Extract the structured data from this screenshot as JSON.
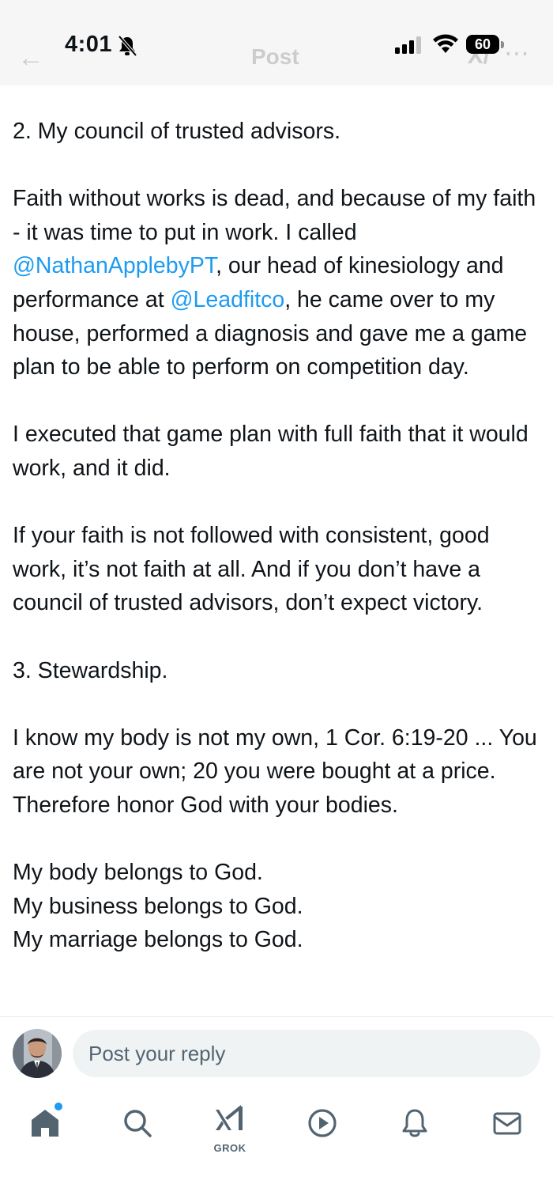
{
  "status_bar": {
    "time": "4:01",
    "battery": "60"
  },
  "header": {
    "back_icon": "back-arrow-icon",
    "title": "Post",
    "grok_icon": "grok-icon",
    "more_icon": "more-icon"
  },
  "post": {
    "paragraphs": [
      {
        "text": "2. My council of trusted advisors."
      },
      {
        "before": "Faith without works is dead, and because of my faith - it was time to put in work. I called ",
        "mention1": "@NathanApplebyPT",
        "middle": ", our head of kinesiology and performance at ",
        "mention2": "@Leadfitco",
        "after": ", he came over to my house, performed a diagnosis and gave me a game plan to be able to perform on competition day."
      },
      {
        "text": "I executed that game plan with full faith that it would work, and it did."
      },
      {
        "text": "If your faith is not followed with consistent, good work, it’s not faith at all. And if you don’t have a council of trusted advisors, don’t expect victory."
      },
      {
        "text": "3. Stewardship."
      },
      {
        "text": "I know my body is not my own, 1 Cor. 6:19-20 ... You are not your own; 20 you were bought at a price. Therefore honor God with your bodies."
      },
      {
        "text": "My body belongs to God."
      },
      {
        "text": "My business belongs to God."
      },
      {
        "text": "My marriage belongs to God."
      }
    ]
  },
  "reply": {
    "placeholder": "Post your reply",
    "avatar": "user-avatar"
  },
  "nav": {
    "items": [
      {
        "icon": "home-icon",
        "active": true,
        "has_notification_dot": true
      },
      {
        "icon": "search-icon"
      },
      {
        "icon": "grok-icon",
        "label": "GROK"
      },
      {
        "icon": "video-play-icon"
      },
      {
        "icon": "notifications-bell-icon"
      },
      {
        "icon": "messages-mail-icon"
      }
    ]
  },
  "colors": {
    "link": "#1d9bf0",
    "text": "#0f1419",
    "muted": "#536471",
    "input_bg": "#eff3f4"
  }
}
